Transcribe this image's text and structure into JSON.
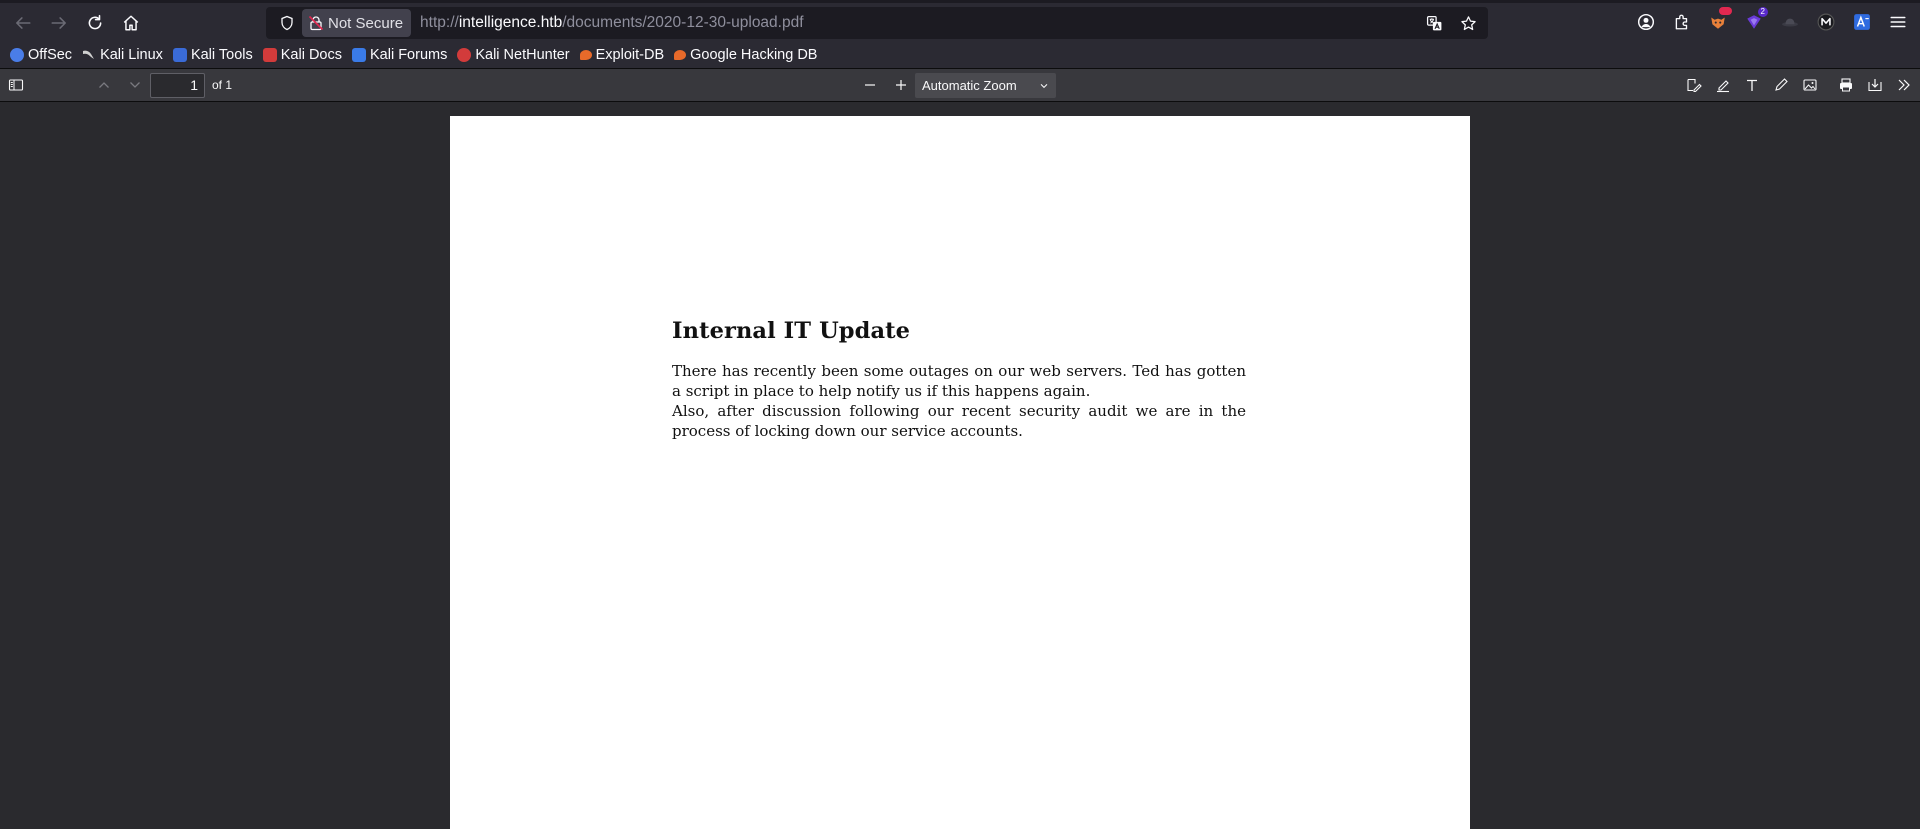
{
  "browser": {
    "url": {
      "scheme": "http://",
      "host": "intelligence.htb",
      "path": "/documents/2020-12-30-upload.pdf"
    },
    "security_label": "Not Secure",
    "extension_badge_count": "2"
  },
  "bookmarks": [
    {
      "label": "OffSec",
      "icon": "offsec-icon",
      "color": "#4a7de8"
    },
    {
      "label": "Kali Linux",
      "icon": "kali-dragon-icon",
      "color": "#d0d0d0"
    },
    {
      "label": "Kali Tools",
      "icon": "kali-tools-icon",
      "color": "#3a6bd8"
    },
    {
      "label": "Kali Docs",
      "icon": "kali-docs-icon",
      "color": "#d23b3b"
    },
    {
      "label": "Kali Forums",
      "icon": "kali-forums-icon",
      "color": "#3a7be8"
    },
    {
      "label": "Kali NetHunter",
      "icon": "kali-nethunter-icon",
      "color": "#d23b3b"
    },
    {
      "label": "Exploit-DB",
      "icon": "exploit-db-icon",
      "color": "#e86a2a"
    },
    {
      "label": "Google Hacking DB",
      "icon": "ghdb-icon",
      "color": "#e86a2a"
    }
  ],
  "pdf_toolbar": {
    "page_number": "1",
    "page_count": "of 1",
    "zoom": "Automatic Zoom"
  },
  "document": {
    "title": "Internal IT Update",
    "paragraphs": [
      "There has recently been some outages on our web servers.  Ted has gotten a script in place to help notify us if this happens again.",
      "Also, after discussion following our recent security audit we are in the process of locking down our service accounts."
    ]
  }
}
